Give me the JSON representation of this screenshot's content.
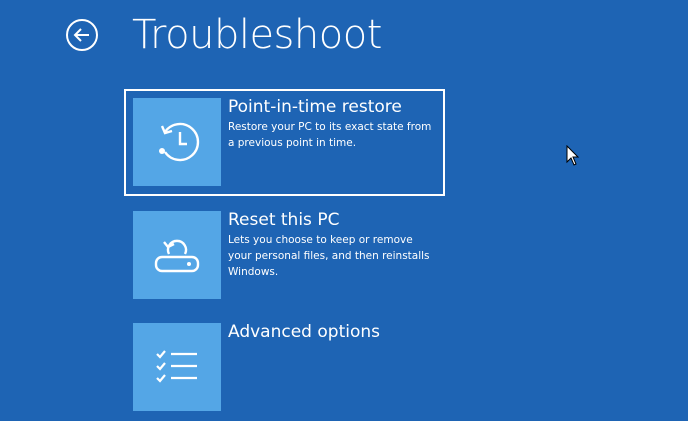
{
  "page": {
    "title": "Troubleshoot",
    "background_color": "#1e64b4",
    "tile_color": "#54a6e6"
  },
  "back": {
    "icon": "arrow-left-circle-icon"
  },
  "options": [
    {
      "title": "Point-in-time restore",
      "description": "Restore your PC to its exact state from a previous point in time.",
      "icon": "clock-restore-icon",
      "selected": true
    },
    {
      "title": "Reset this PC",
      "description": "Lets you choose to keep or remove your personal files, and then reinstalls Windows.",
      "icon": "reset-pc-icon",
      "selected": false
    },
    {
      "title": "Advanced options",
      "description": "",
      "icon": "checklist-icon",
      "selected": false
    }
  ],
  "pointer": {
    "icon": "mouse-pointer-icon"
  }
}
